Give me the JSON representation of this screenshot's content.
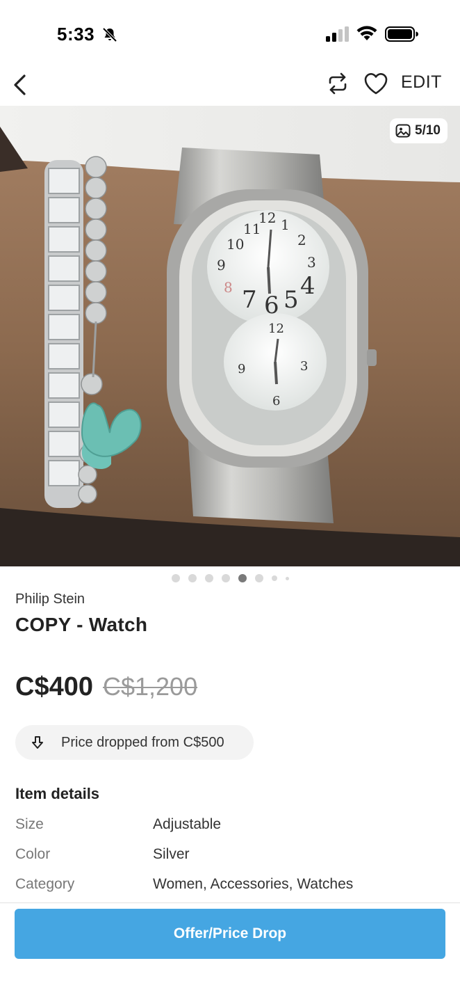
{
  "status_bar": {
    "time": "5:33",
    "icons": [
      "bell-slash-icon",
      "cellular-signal-icon",
      "wifi-icon",
      "battery-icon"
    ]
  },
  "nav": {
    "back_icon": "chevron-left-icon",
    "share_icon": "repost-icon",
    "like_icon": "heart-icon",
    "edit_label": "EDIT"
  },
  "photo": {
    "alt_description_icon": "gallery-icon",
    "counter": "5/10",
    "current_index": 5,
    "total": 10
  },
  "listing": {
    "brand": "Philip Stein",
    "title": "COPY - Watch",
    "price": "C$400",
    "original_price": "C$1,200",
    "price_drop_text": "Price dropped from C$500"
  },
  "details": {
    "heading": "Item details",
    "rows": [
      {
        "label": "Size",
        "value": "Adjustable"
      },
      {
        "label": "Color",
        "value": "Silver"
      },
      {
        "label": "Category",
        "value": "Women, Accessories, Watches"
      }
    ]
  },
  "cta": {
    "label": "Offer/Price Drop"
  },
  "colors": {
    "accent": "#45a6e2",
    "strike": "#9a9a9a",
    "pill_bg": "#f3f3f3"
  }
}
